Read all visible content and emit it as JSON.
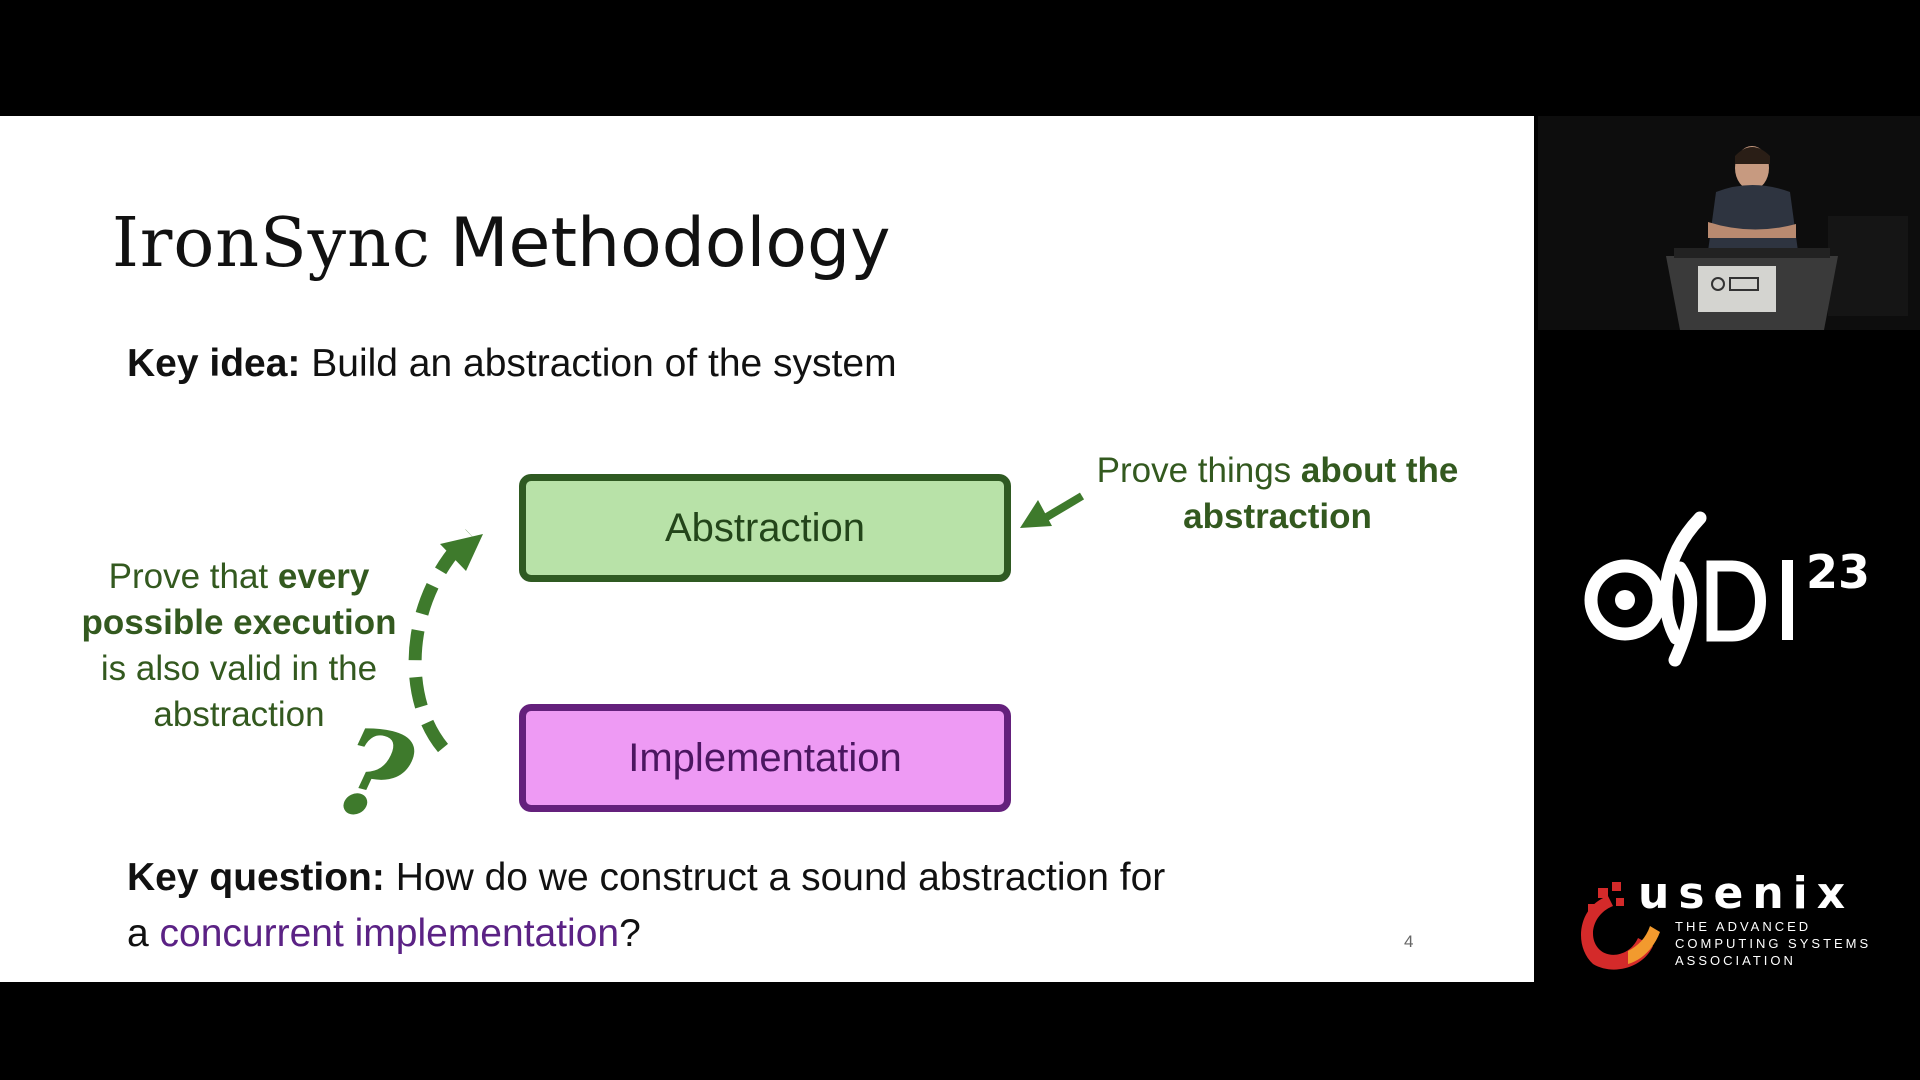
{
  "slide": {
    "title_part1": "IronSync",
    "title_part2": "Methodology",
    "key_idea_label": "Key idea:",
    "key_idea_text": "Build an abstraction of the system",
    "abstraction_label": "Abstraction",
    "implementation_label": "Implementation",
    "right_note_plain": "Prove things ",
    "right_note_bold": "about the abstraction",
    "left_note_1": "Prove that ",
    "left_note_bold": "every possible execution",
    "left_note_2": " is also valid in the abstraction",
    "question_mark": "?",
    "key_question_label": "Key question:",
    "key_question_text": "How do we construct a sound abstraction for",
    "key_question_line2_prefix": "a ",
    "key_question_highlight": "concurrent implementation",
    "key_question_suffix": "?",
    "page_number": "4"
  },
  "branding": {
    "osdi_superscript": "23",
    "usenix_word": "usenix",
    "usenix_tagline": "THE ADVANCED\nCOMPUTING SYSTEMS\nASSOCIATION"
  },
  "colors": {
    "green_dark": "#2f5a22",
    "green_fill": "#b8e2a8",
    "purple_dark": "#64207c",
    "purple_fill": "#ee9af4",
    "highlight_purple": "#5b2285",
    "usenix_red": "#d42a2a"
  }
}
